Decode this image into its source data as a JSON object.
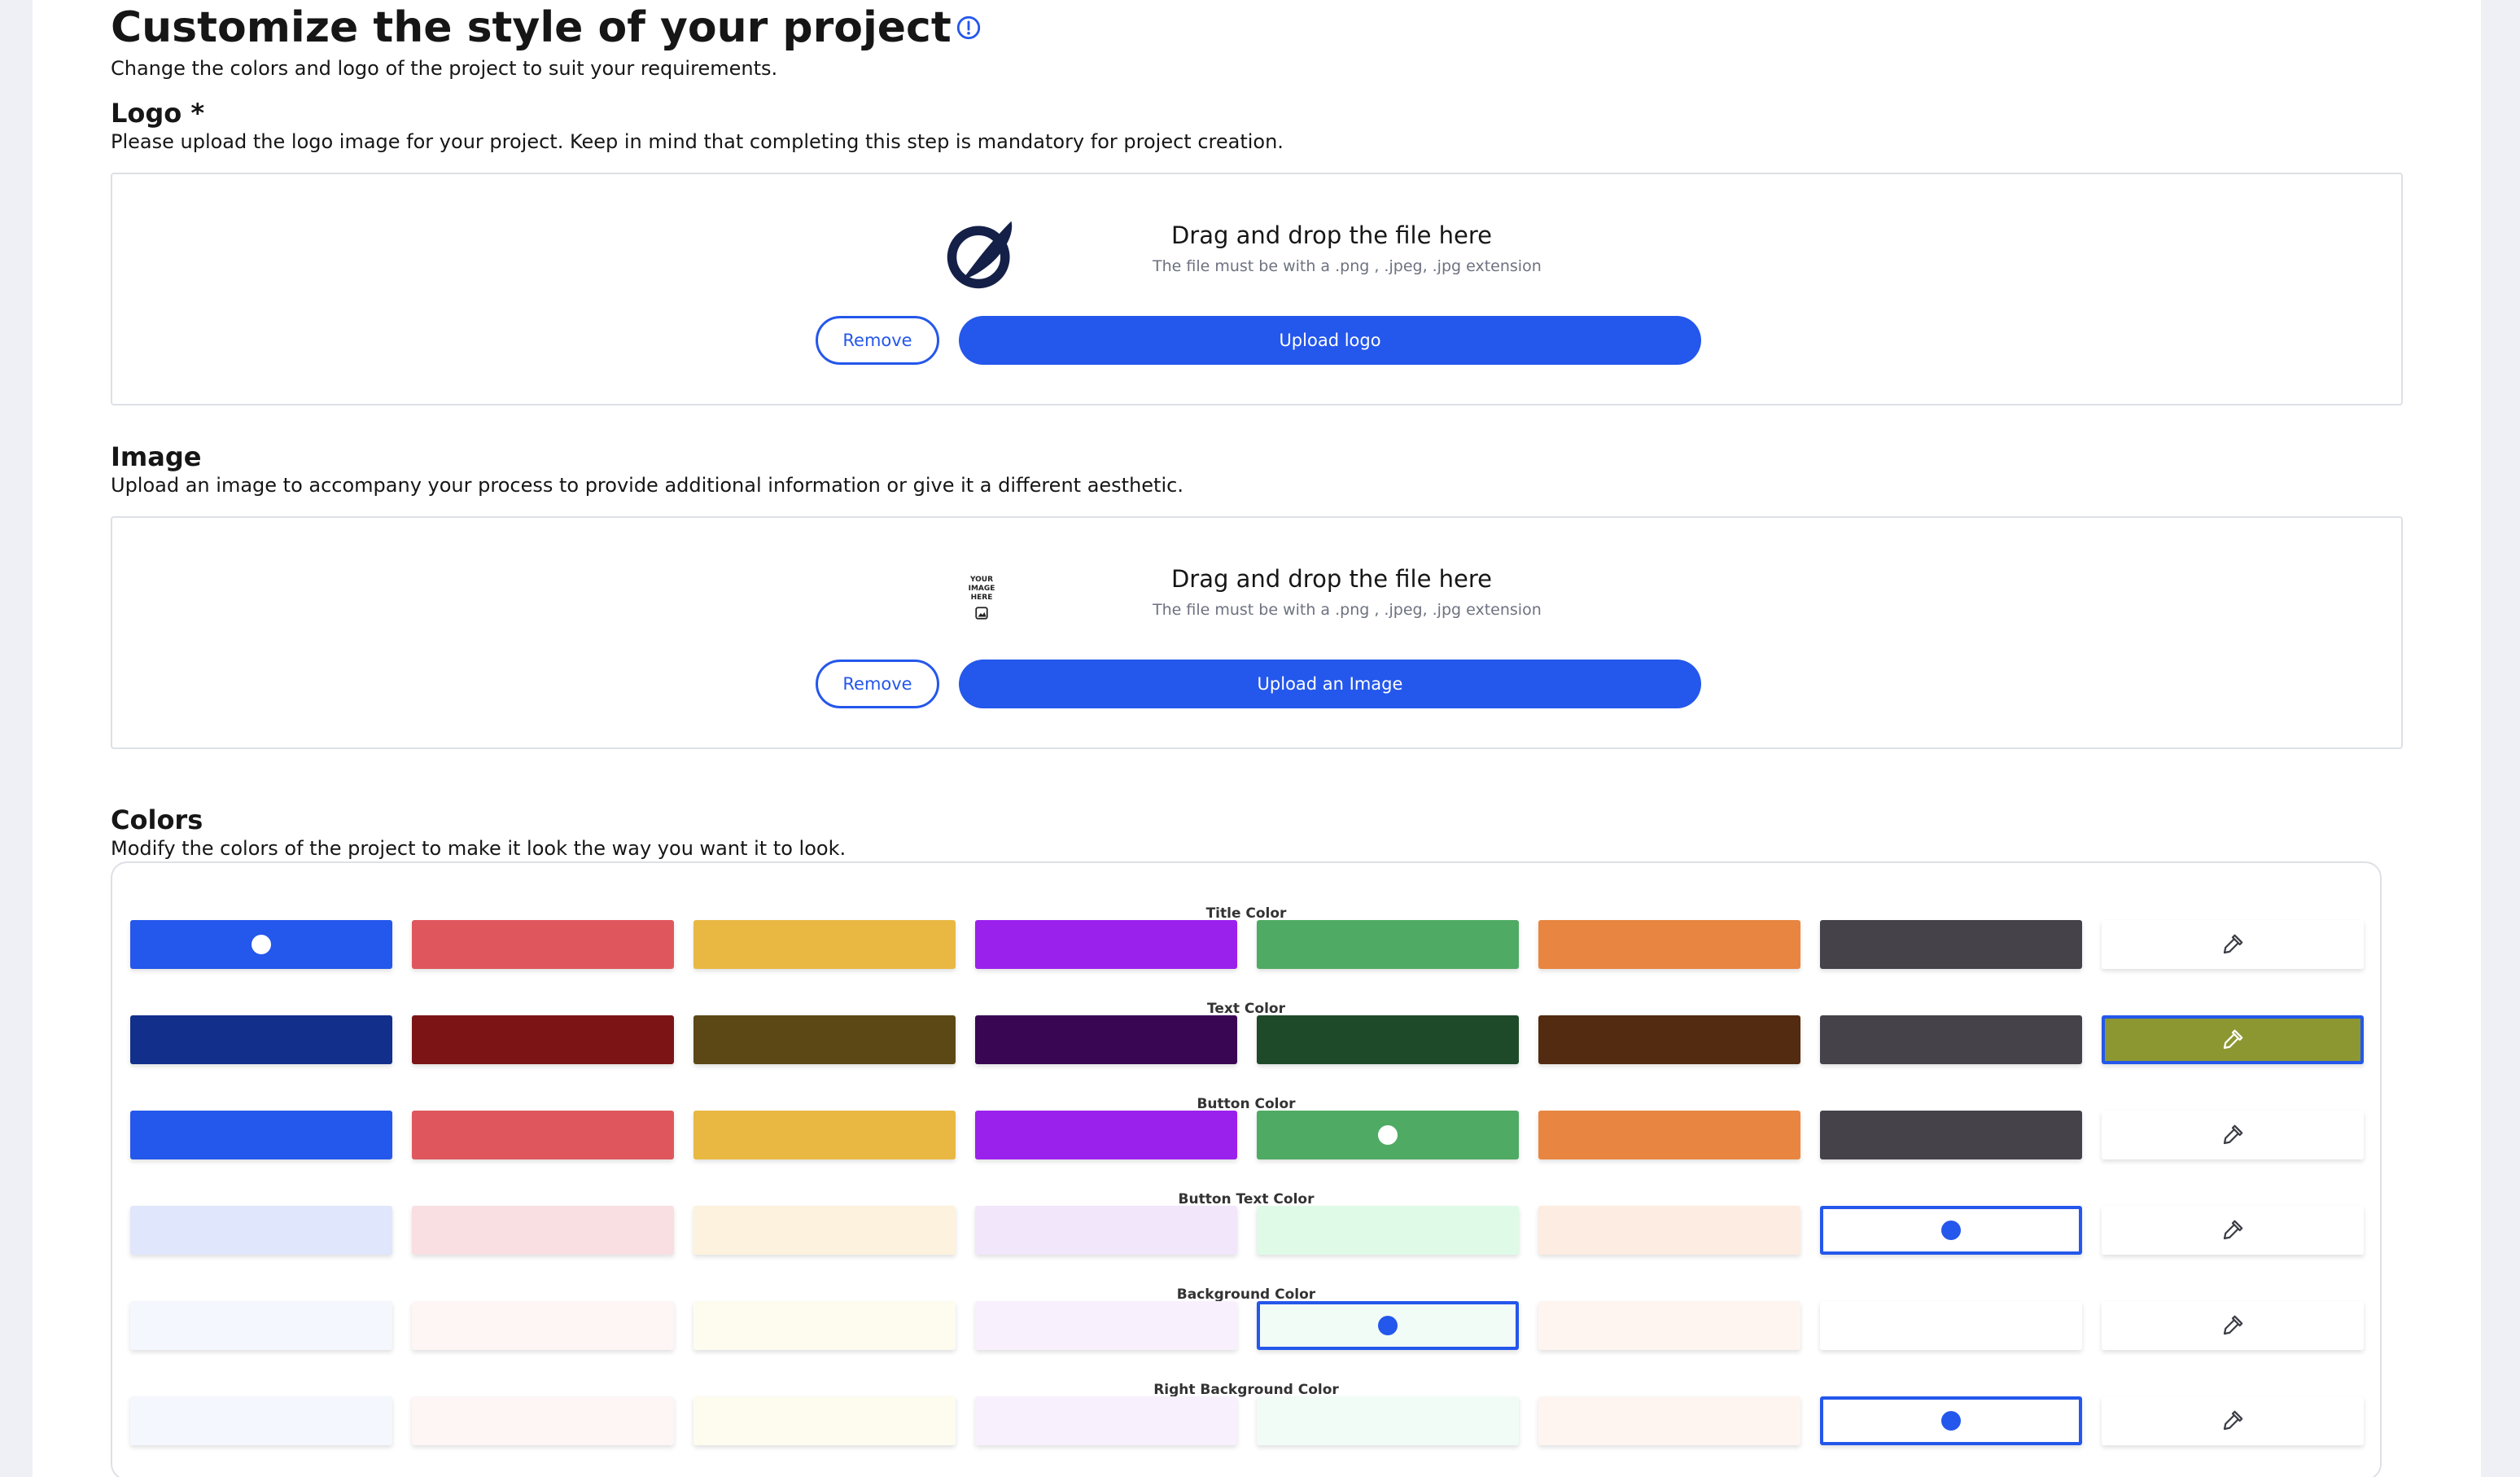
{
  "header": {
    "title": "Customize the style of your project",
    "subtitle": "Change the colors and logo of the project to suit your requirements."
  },
  "logo_section": {
    "title": "Logo *",
    "description": "Please upload the logo image for your project. Keep in mind that completing this step is mandatory for project creation.",
    "drop_title": "Drag and drop the file here",
    "drop_hint": "The file must be with a .png , .jpeg, .jpg extension",
    "remove_label": "Remove",
    "upload_label": "Upload logo"
  },
  "image_section": {
    "title": "Image",
    "description": "Upload an image to accompany your process to provide additional information or give it a different aesthetic.",
    "placeholder_text": [
      "YOUR",
      "IMAGE",
      "HERE"
    ],
    "drop_title": "Drag and drop the file here",
    "drop_hint": "The file must be with a .png , .jpeg, .jpg extension",
    "remove_label": "Remove",
    "upload_label": "Upload an Image"
  },
  "colors_section": {
    "title": "Colors",
    "description": "Modify the colors of the project to make it look the way you want it to look.",
    "picker_icon": "eyedropper-icon",
    "rows": [
      {
        "label": "Title Color",
        "swatches": [
          "#2457eb",
          "#df575d",
          "#e8b843",
          "#9a21ec",
          "#4fab63",
          "#e88540",
          "#45424a"
        ],
        "selected_index": 0,
        "selection_style": "dot",
        "dot_color": "#ffffff",
        "picker_color": "#ffffff",
        "picker_selected": false
      },
      {
        "label": "Text Color",
        "swatches": [
          "#122f8c",
          "#7c1416",
          "#5b4815",
          "#390653",
          "#1f4a2a",
          "#532b10",
          "#45424a"
        ],
        "selected_index": null,
        "selection_style": "none",
        "dot_color": "",
        "picker_color": "#8d9732",
        "picker_selected": true
      },
      {
        "label": "Button Color",
        "swatches": [
          "#2457eb",
          "#df575d",
          "#e8b843",
          "#9a21ec",
          "#4fab63",
          "#e88540",
          "#45424a"
        ],
        "selected_index": 4,
        "selection_style": "dot",
        "dot_color": "#ffffff",
        "picker_color": "#ffffff",
        "picker_selected": false
      },
      {
        "label": "Button Text Color",
        "swatches": [
          "#e0e6fc",
          "#f9dfe1",
          "#fdf2dd",
          "#f2e6fb",
          "#dffbe8",
          "#fcece1",
          "#ffffff"
        ],
        "selected_index": 6,
        "selection_style": "border",
        "dot_color": "#2457eb",
        "picker_color": "#ffffff",
        "picker_selected": false
      },
      {
        "label": "Background Color",
        "swatches": [
          "#f5f7fe",
          "#fef5f5",
          "#fefcef",
          "#f8f1fd",
          "#f2fcf6",
          "#fef5f1",
          "#ffffff"
        ],
        "selected_index": 4,
        "selection_style": "border",
        "dot_color": "#2457eb",
        "picker_color": "#ffffff",
        "picker_selected": false
      },
      {
        "label": "Right Background Color",
        "swatches": [
          "#f5f7fe",
          "#fef5f5",
          "#fefcef",
          "#f8f1fd",
          "#f2fcf6",
          "#fef5f1",
          "#ffffff"
        ],
        "selected_index": 6,
        "selection_style": "border",
        "dot_color": "#2457eb",
        "picker_color": "#ffffff",
        "picker_selected": false
      }
    ]
  },
  "theme": {
    "accent": "#2457eb",
    "border": "#dde0e6"
  }
}
